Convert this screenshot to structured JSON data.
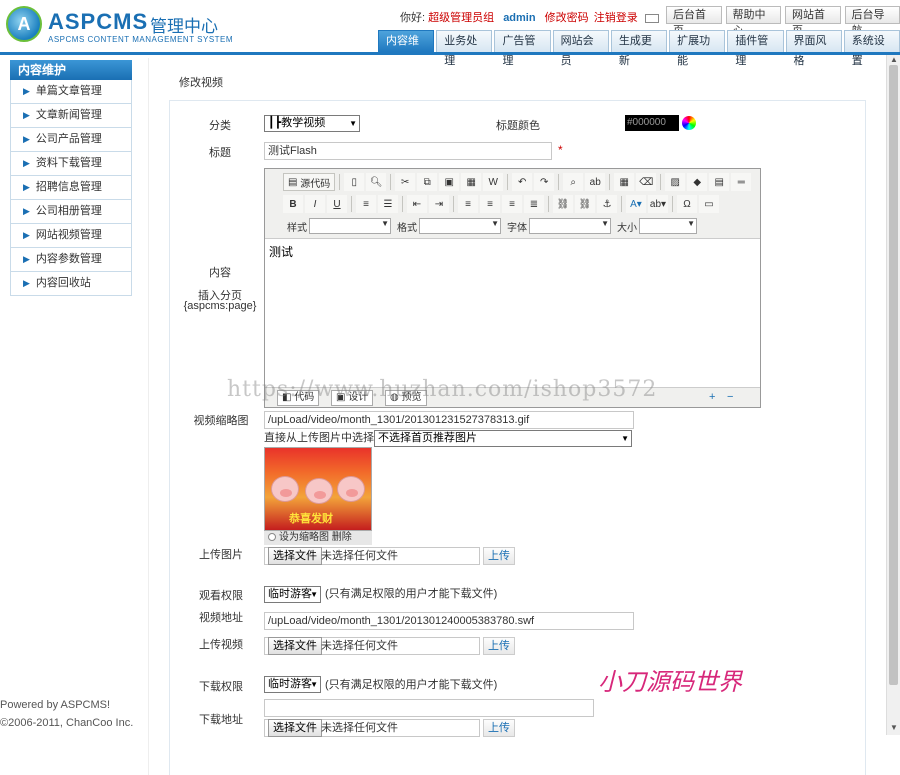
{
  "header": {
    "brand": "ASPCMS",
    "brand_cn": "管理中心",
    "brand_sub": "ASPCMS CONTENT MANAGEMENT SYSTEM",
    "hello": "你好:",
    "role": "超级管理员组",
    "username": "admin",
    "change_password": "修改密码",
    "logout": "注销登录",
    "top_buttons": [
      "后台首页",
      "帮助中心",
      "网站首页",
      "后台导航"
    ],
    "nav_tabs": [
      "内容维护",
      "业务处理",
      "广告管理",
      "网站会员",
      "生成更新",
      "扩展功能",
      "插件管理",
      "界面风格",
      "系统设置"
    ]
  },
  "sidebar": {
    "title": "内容维护",
    "items": [
      "单篇文章管理",
      "文章新闻管理",
      "公司产品管理",
      "资料下载管理",
      "招聘信息管理",
      "公司相册管理",
      "网站视频管理",
      "内容参数管理",
      "内容回收站"
    ],
    "powered": "Powered by ASPCMS!",
    "copyright": "©2006-2011, ChanCoo Inc."
  },
  "page": {
    "breadcrumb": "修改视频"
  },
  "form": {
    "category_label": "分类",
    "category_value": "┃┣教学视频",
    "title_color_label": "标题颜色",
    "title_color_value": "#000000",
    "title_label": "标题",
    "title_value": "测试Flash",
    "required_mark": "*",
    "content_label": "内容",
    "pagebreak_label": "插入分页",
    "pagebreak_code": "{aspcms:page}",
    "editor": {
      "source_button": "源代码",
      "style_label": "样式",
      "format_label": "格式",
      "font_label": "字体",
      "size_label": "大小",
      "content": "测试",
      "tab_code": "代码",
      "tab_design": "设计",
      "tab_preview": "预览",
      "zoom_in": "+",
      "zoom_out": "−"
    },
    "thumb_label": "视频缩略图",
    "thumb_path": "/upLoad/video/month_1301/201301231527378313.gif",
    "choose_from_label": "直接从上传图片中选择：",
    "choose_from_value": "不选择首页推荐图片",
    "thumb_image_text": "恭喜发财",
    "thumb_caption": "设为缩略图 删除",
    "upload_image_label": "上传图片",
    "choose_file": "选择文件",
    "no_file": "未选择任何文件",
    "upload": "上传",
    "view_permission_label": "观看权限",
    "view_permission_value": "临时游客",
    "view_permission_note": "(只有满足权限的用户才能下载文件)",
    "video_url_label": "视频地址",
    "video_url_value": "/upLoad/video/month_1301/201301240005383780.swf",
    "upload_video_label": "上传视频",
    "download_permission_label": "下载权限",
    "download_permission_value": "临时游客",
    "download_permission_note": "(只有满足权限的用户才能下载文件)",
    "download_url_label": "下载地址",
    "download_url_value": ""
  },
  "overlay": {
    "watermark": "https://www.huzhan.com/ishop3572",
    "signature": "小刀源码世界"
  }
}
